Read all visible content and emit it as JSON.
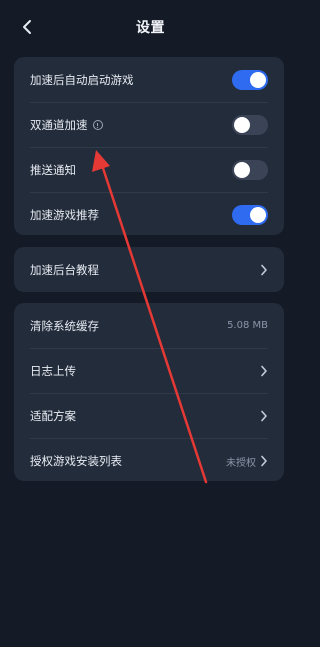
{
  "header": {
    "title": "设置",
    "back_icon": "chevron-left-icon"
  },
  "toggles": [
    {
      "label": "加速后自动启动游戏",
      "state": "on"
    },
    {
      "label": "双通道加速",
      "state": "off",
      "info_icon": "info-icon"
    },
    {
      "label": "推送通知",
      "state": "off"
    },
    {
      "label": "加速游戏推荐",
      "state": "on"
    }
  ],
  "tutorial": {
    "label": "加速后台教程"
  },
  "misc": {
    "clear_cache": {
      "label": "清除系统缓存",
      "value": "5.08 MB"
    },
    "log_upload": {
      "label": "日志上传"
    },
    "adaptation": {
      "label": "适配方案"
    },
    "auth_list": {
      "label": "授权游戏安装列表",
      "value": "未授权"
    }
  },
  "colors": {
    "background": "#151b26",
    "card": "#232c3b",
    "toggle_on": "#2f6bf0",
    "toggle_off": "#3a4456",
    "annotation_arrow": "#e53935"
  }
}
